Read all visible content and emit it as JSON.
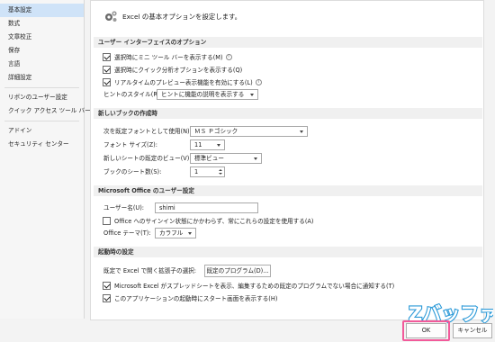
{
  "sidebar": {
    "items": [
      {
        "label": "基本設定",
        "selected": true
      },
      {
        "label": "数式"
      },
      {
        "label": "文章校正"
      },
      {
        "label": "保存"
      },
      {
        "label": "言語"
      },
      {
        "label": "詳細設定"
      },
      {
        "label": "リボンのユーザー設定"
      },
      {
        "label": "クイック アクセス ツール バー"
      },
      {
        "label": "アドイン"
      },
      {
        "label": "セキュリティ センター"
      }
    ]
  },
  "header": {
    "text": "Excel の基本オプションを設定します。"
  },
  "ui_section": {
    "title": "ユーザー インターフェイスのオプション",
    "opt_minitoolbar": "選択時にミニ ツール バーを表示する(M)",
    "opt_quickanalysis": "選択時にクイック分析オプションを表示する(Q)",
    "opt_livepreview": "リアルタイムのプレビュー表示機能を有効にする(L)",
    "tooltip_style_label": "ヒントのスタイル(R):",
    "tooltip_style_value": "ヒントに機能の説明を表示する"
  },
  "newbook_section": {
    "title": "新しいブックの作成時",
    "font_label": "次を既定フォントとして使用(N):",
    "font_value": "ＭＳ Ｐゴシック",
    "size_label": "フォント サイズ(Z):",
    "size_value": "11",
    "view_label": "新しいシートの既定のビュー(V):",
    "view_value": "標準ビュー",
    "sheets_label": "ブックのシート数(S):",
    "sheets_value": "1"
  },
  "office_section": {
    "title": "Microsoft Office のユーザー設定",
    "username_label": "ユーザー名(U):",
    "username_value": "shimi",
    "always_use": "Office へのサインイン状態にかかわらず、常にこれらの設定を使用する(A)",
    "theme_label": "Office テーマ(T):",
    "theme_value": "カラフル"
  },
  "startup_section": {
    "title": "起動時の設定",
    "default_program_label": "既定で Excel で開く拡張子の選択:",
    "default_program_button": "既定のプログラム(D)...",
    "notify_default": "Microsoft Excel がスプレッドシートを表示、編集するための既定のプログラムでない場合に通知する(T)",
    "show_start": "このアプリケーションの起動時にスタート画面を表示する(H)"
  },
  "footer": {
    "ok": "OK",
    "cancel": "キャンセル"
  },
  "watermark": {
    "text": "Zバッファ"
  },
  "colors": {
    "selected": "#cfe3f8",
    "highlight": "#f25a9a"
  }
}
